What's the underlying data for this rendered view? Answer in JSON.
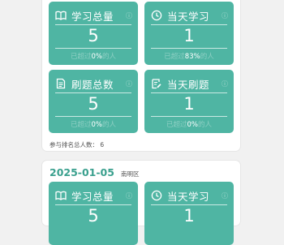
{
  "stats_card": {
    "tiles": [
      {
        "icon": "book-icon",
        "label": "学习总量",
        "hint": "ⓘ",
        "value": "5",
        "rate_prefix": "已超过",
        "rate_value": "0%",
        "rate_suffix": "的人"
      },
      {
        "icon": "clock-icon",
        "label": "当天学习",
        "hint": "ⓘ",
        "value": "1",
        "rate_prefix": "已超过",
        "rate_value": "83%",
        "rate_suffix": "的人"
      },
      {
        "icon": "document-icon",
        "label": "刷题总数",
        "hint": "ⓘ",
        "value": "5",
        "rate_prefix": "已超过",
        "rate_value": "0%",
        "rate_suffix": "的人"
      },
      {
        "icon": "edit-icon",
        "label": "当天刷题",
        "hint": "ⓘ",
        "value": "1",
        "rate_prefix": "已超过",
        "rate_value": "0%",
        "rate_suffix": "的人"
      }
    ],
    "footer": "参与排名总人数： 6"
  },
  "day_card": {
    "date": "2025-01-05",
    "district": "南明区",
    "tiles": [
      {
        "icon": "book-icon",
        "label": "学习总量",
        "hint": "ⓘ",
        "value": "5"
      },
      {
        "icon": "clock-icon",
        "label": "当天学习",
        "hint": "ⓘ",
        "value": "1"
      }
    ]
  },
  "colors": {
    "tile_bg": "#4fb5a3",
    "date_text": "#3aa08e",
    "page_bg": "#f1f1f1"
  }
}
